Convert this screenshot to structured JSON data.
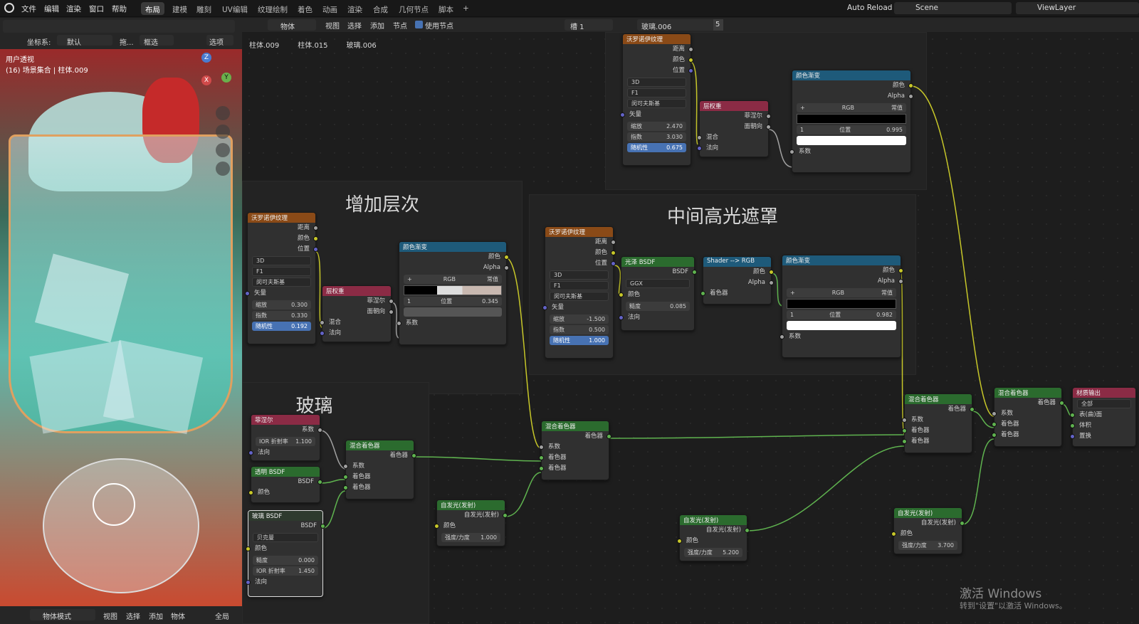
{
  "topbar": {
    "menus": [
      "文件",
      "编辑",
      "渲染",
      "窗口",
      "帮助"
    ],
    "workspaces": [
      "布局",
      "建模",
      "雕刻",
      "UV编辑",
      "纹理绘制",
      "着色",
      "动画",
      "渲染",
      "合成",
      "几何节点",
      "脚本"
    ],
    "active_workspace": "布局",
    "add_tab": "+",
    "auto_reload": "Auto Reload",
    "scene": "Scene",
    "view_layer": "ViewLayer"
  },
  "viewport": {
    "coord_label": "坐标系:",
    "coord_value": "默认",
    "drag_label": "拖...",
    "select_mode": "框选",
    "options": "选项",
    "view_name": "用户透视",
    "collection": "(16) 场景集合 | 柱体.009",
    "axis_x": "X",
    "axis_y": "Y",
    "axis_z": "Z",
    "mode": "物体模式",
    "bottom_menus": [
      "视图",
      "选择",
      "添加",
      "物体"
    ],
    "global": "全局"
  },
  "node_header": {
    "type": "物体",
    "menus": [
      "视图",
      "选择",
      "添加",
      "节点"
    ],
    "use_nodes": "使用节点",
    "slot": "槽 1",
    "material": "玻璃.006",
    "users": "5"
  },
  "breadcrumb": [
    "柱体.009",
    "柱体.015",
    "玻璃.006"
  ],
  "frames": {
    "layers": "增加层次",
    "mask": "中间高光遮罩",
    "glass": "玻璃"
  },
  "labels": {
    "voronoi": "沃罗诺伊纹理",
    "ramp": "颜色渐变",
    "layerweight": "层权重",
    "mix": "混合着色器",
    "emission": "自发光(发射)",
    "fresnel": "菲涅尔",
    "transparent": "透明 BSDF",
    "glass": "玻璃 BSDF",
    "glossy": "光泽 BSDF",
    "s2rgb": "Shader --> RGB",
    "output": "材质输出",
    "distance": "距离",
    "color": "颜色",
    "position": "位置",
    "vector": "矢量",
    "scale": "缩放",
    "detail": "指数",
    "random": "随机性",
    "fresnel_out": "菲涅尔",
    "facing": "面朝向",
    "blend": "混合",
    "normal": "法向",
    "fac": "系数",
    "shader": "着色器",
    "alpha": "Alpha",
    "bsdf": "BSDF",
    "emit_out": "自发光(发射)",
    "strength": "强度/力度",
    "roughness": "糙度",
    "ior": "IOR 折射率",
    "surface": "表(曲)面",
    "volume": "体积",
    "displace": "置换",
    "all": "全部",
    "d3": "3D",
    "f1": "F1",
    "dist_metric": "闵可夫斯基",
    "rgb": "RGB",
    "interp": "常值",
    "ggx": "GGX",
    "beckmann": "贝克曼",
    "pos_label": "位置",
    "stop": "1",
    "plus": "+",
    "minus": "−",
    "chevron": "⌄"
  },
  "values": {
    "v1_scale": "2.470",
    "v1_detail": "3.030",
    "v1_rand": "0.675",
    "r1_pos": "0.995",
    "v2_scale": "0.300",
    "v2_detail": "0.330",
    "v2_rand": "0.192",
    "r2_pos": "0.345",
    "v3_scale": "-1.500",
    "v3_detail": "0.500",
    "v3_rand": "1.000",
    "gl_rough": "0.085",
    "r3_pos": "0.982",
    "fr_ior": "1.100",
    "gb_rough": "0.000",
    "gb_ior": "1.450",
    "e1_str": "1.000",
    "e2_str": "5.200",
    "e3_str": "3.700"
  },
  "watermark": {
    "line1": "激活 Windows",
    "line2": "转到\"设置\"以激活 Windows。"
  }
}
